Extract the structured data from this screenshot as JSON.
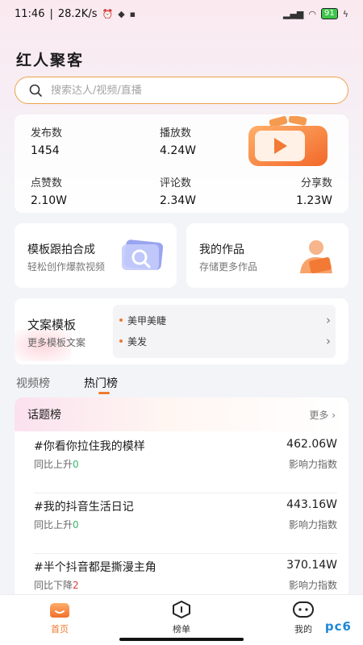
{
  "status_bar": {
    "time": "11:46",
    "network_speed": "28.2K/s",
    "battery": "91"
  },
  "app": {
    "title": "红人聚客"
  },
  "search": {
    "placeholder": "搜索达人/视频/直播"
  },
  "stats": [
    {
      "label": "发布数",
      "value": "1454"
    },
    {
      "label": "播放数",
      "value": "4.24W"
    },
    {
      "label": "点赞数",
      "value": "2.10W"
    },
    {
      "label": "评论数",
      "value": "2.34W"
    },
    {
      "label": "分享数",
      "value": "1.23W"
    }
  ],
  "features": [
    {
      "title": "模板跟拍合成",
      "subtitle": "轻松创作爆款视频",
      "icon": "search-template-icon"
    },
    {
      "title": "我的作品",
      "subtitle": "存储更多作品",
      "icon": "my-works-icon"
    }
  ],
  "template": {
    "title": "文案模板",
    "subtitle": "更多模板文案",
    "items": [
      "美甲美睫",
      "美发"
    ]
  },
  "tabs": [
    "视频榜",
    "热门榜"
  ],
  "active_tab": "热门榜",
  "topic_list": {
    "title": "话题榜",
    "more": "更多",
    "rows": [
      {
        "name": "#你看你拉住我的模样",
        "trend_label": "同比上升",
        "trend_value": "0",
        "trend": "up",
        "value": "462.06W",
        "value_label": "影响力指数"
      },
      {
        "name": "#我的抖音生活日记",
        "trend_label": "同比上升",
        "trend_value": "0",
        "trend": "up",
        "value": "443.16W",
        "value_label": "影响力指数"
      },
      {
        "name": "#半个抖音都是撕漫主角",
        "trend_label": "同比下降",
        "trend_value": "2",
        "trend": "down",
        "value": "370.14W",
        "value_label": "影响力指数"
      }
    ]
  },
  "bottom_nav": [
    {
      "label": "首页",
      "icon": "home-icon",
      "active": true
    },
    {
      "label": "榜单",
      "icon": "ranking-icon",
      "active": false
    },
    {
      "label": "我的",
      "icon": "profile-icon",
      "active": false
    }
  ],
  "watermark": "pc6",
  "colors": {
    "accent": "#f07a2c",
    "up": "#3bb76e",
    "down": "#e23d3d"
  }
}
